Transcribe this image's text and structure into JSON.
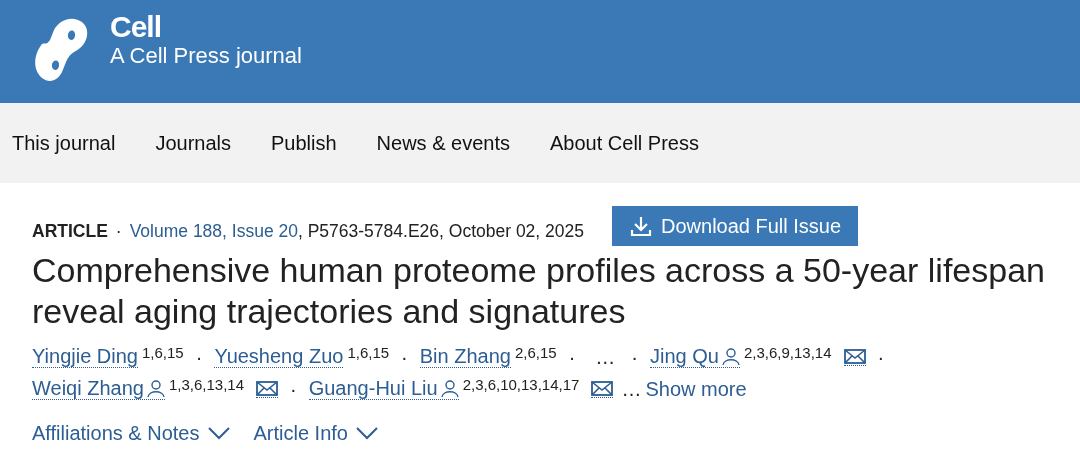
{
  "header": {
    "title": "Cell",
    "subtitle": "A Cell Press journal"
  },
  "nav": [
    "This journal",
    "Journals",
    "Publish",
    "News & events",
    "About Cell Press"
  ],
  "meta": {
    "type": "ARTICLE",
    "separator": "·",
    "issue": "Volume 188, Issue 20",
    "pages": ", P5763-5784.E26, October 02, 2025"
  },
  "download_button": "Download Full Issue",
  "title": "Comprehensive human proteome profiles across a 50-year lifespan reveal aging trajectories and signatures",
  "author_lines": [
    [
      {
        "kind": "author",
        "name": "Yingjie Ding",
        "affiliations": "1,6,15",
        "corresponding": false,
        "email": false
      },
      {
        "kind": "separator",
        "text": "·"
      },
      {
        "kind": "author",
        "name": "Yuesheng Zuo",
        "affiliations": "1,6,15",
        "corresponding": false,
        "email": false
      },
      {
        "kind": "separator",
        "text": "·"
      },
      {
        "kind": "author",
        "name": "Bin Zhang",
        "affiliations": "2,6,15",
        "corresponding": false,
        "email": false
      },
      {
        "kind": "separator",
        "text": "·"
      },
      {
        "kind": "ellipsis",
        "text": "…"
      },
      {
        "kind": "separator",
        "text": "·"
      },
      {
        "kind": "author",
        "name": "Jing Qu",
        "affiliations": "2,3,6,9,13,14",
        "corresponding": true,
        "email": true
      },
      {
        "kind": "separator",
        "text": "·"
      }
    ],
    [
      {
        "kind": "author",
        "name": "Weiqi Zhang",
        "affiliations": "1,3,6,13,14",
        "corresponding": true,
        "email": true
      },
      {
        "kind": "separator",
        "text": "·"
      },
      {
        "kind": "author",
        "name": "Guang-Hui Liu",
        "affiliations": "2,3,6,10,13,14,17",
        "corresponding": true,
        "email": true
      },
      {
        "kind": "ellipsis",
        "text": "…"
      },
      {
        "kind": "link",
        "text": "Show more"
      }
    ]
  ],
  "toggles": [
    {
      "label": "Affiliations & Notes",
      "expanded": false
    },
    {
      "label": "Article Info",
      "expanded": false
    }
  ]
}
